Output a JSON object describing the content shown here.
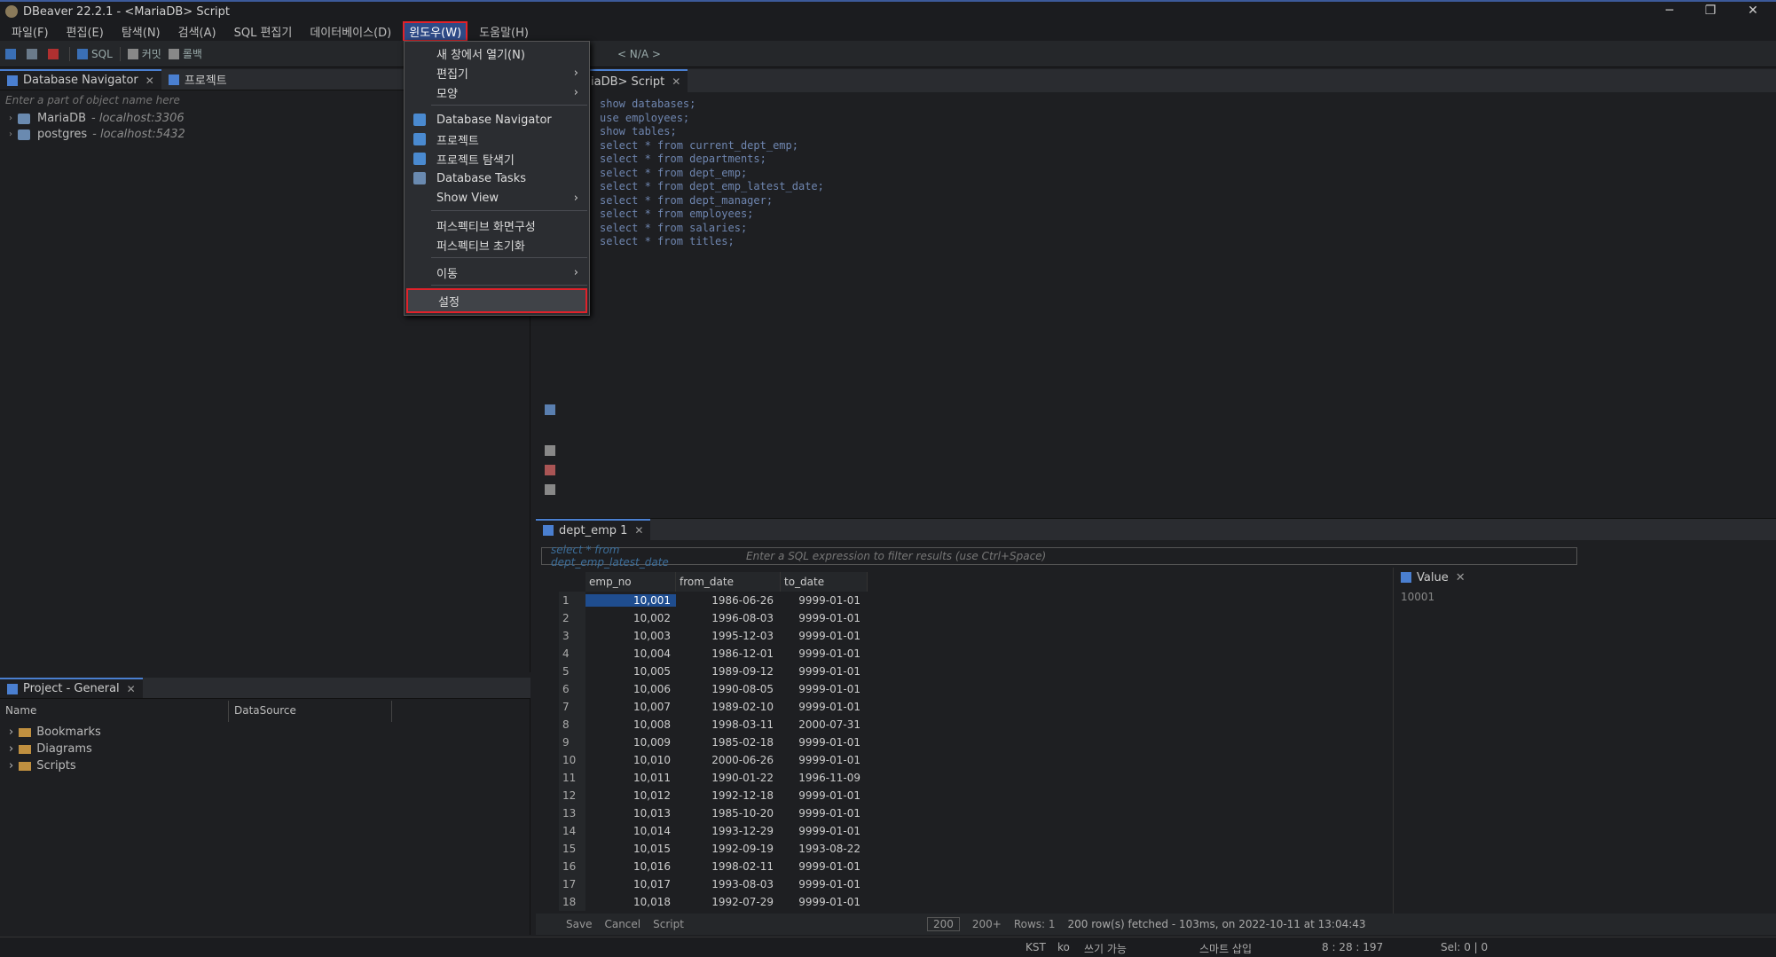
{
  "window": {
    "title": "DBeaver 22.2.1 - <MariaDB> Script",
    "minimize": "─",
    "restore": "❐",
    "close": "✕"
  },
  "menubar": {
    "items": [
      {
        "label": "파일(F)"
      },
      {
        "label": "편집(E)"
      },
      {
        "label": "탐색(N)"
      },
      {
        "label": "검색(A)"
      },
      {
        "label": "SQL 편집기"
      },
      {
        "label": "데이터베이스(D)"
      },
      {
        "label": "윈도우(W)"
      },
      {
        "label": "도움말(H)"
      }
    ]
  },
  "toolbar": {
    "sql_label": "SQL",
    "commit_label": "커밋",
    "rollback_label": "롤백",
    "na_label": "< N/A >"
  },
  "window_menu": {
    "items": [
      {
        "label": "새 창에서 열기(N)",
        "submenu": false
      },
      {
        "label": "편집기",
        "submenu": true
      },
      {
        "label": "모양",
        "submenu": true
      },
      {
        "label": "Database Navigator",
        "submenu": false
      },
      {
        "label": "프로젝트",
        "submenu": false
      },
      {
        "label": "프로젝트 탐색기",
        "submenu": false
      },
      {
        "label": "Database Tasks",
        "submenu": false
      },
      {
        "label": "Show View",
        "submenu": true
      },
      {
        "label": "퍼스펙티브 화면구성",
        "submenu": false
      },
      {
        "label": "퍼스펙티브 초기화",
        "submenu": false
      },
      {
        "label": "이동",
        "submenu": true
      },
      {
        "label": "설정",
        "submenu": false
      }
    ],
    "arrow": "›"
  },
  "navigator": {
    "tab_label": "Database Navigator",
    "project_tab_label": "프로젝트",
    "filter_placeholder": "Enter a part of object name here",
    "connections": [
      {
        "name": "MariaDB",
        "host": "- localhost:3306"
      },
      {
        "name": "postgres",
        "host": "- localhost:5432"
      }
    ]
  },
  "project_panel": {
    "tab_label": "Project - General",
    "col_name": "Name",
    "col_datasource": "DataSource",
    "folders": [
      "Bookmarks",
      "Diagrams",
      "Scripts"
    ]
  },
  "editor": {
    "tab_label": "iaDB> Script",
    "lines": [
      "show databases;",
      "use employees;",
      "show tables;",
      "select * from current_dept_emp;",
      "select * from departments;",
      "select * from dept_emp;",
      "select * from dept_emp_latest_date;",
      "select * from dept_manager;",
      "select * from employees;",
      "select * from salaries;",
      "select * from titles;"
    ]
  },
  "results": {
    "tab_label": "dept_emp 1",
    "query_text": "select * from dept_emp_latest_date",
    "filter_placeholder": "Enter a SQL expression to filter results (use Ctrl+Space)",
    "columns": [
      "emp_no",
      "from_date",
      "to_date"
    ],
    "rows": [
      [
        "1",
        "10,001",
        "1986-06-26",
        "9999-01-01"
      ],
      [
        "2",
        "10,002",
        "1996-08-03",
        "9999-01-01"
      ],
      [
        "3",
        "10,003",
        "1995-12-03",
        "9999-01-01"
      ],
      [
        "4",
        "10,004",
        "1986-12-01",
        "9999-01-01"
      ],
      [
        "5",
        "10,005",
        "1989-09-12",
        "9999-01-01"
      ],
      [
        "6",
        "10,006",
        "1990-08-05",
        "9999-01-01"
      ],
      [
        "7",
        "10,007",
        "1989-02-10",
        "9999-01-01"
      ],
      [
        "8",
        "10,008",
        "1998-03-11",
        "2000-07-31"
      ],
      [
        "9",
        "10,009",
        "1985-02-18",
        "9999-01-01"
      ],
      [
        "10",
        "10,010",
        "2000-06-26",
        "9999-01-01"
      ],
      [
        "11",
        "10,011",
        "1990-01-22",
        "1996-11-09"
      ],
      [
        "12",
        "10,012",
        "1992-12-18",
        "9999-01-01"
      ],
      [
        "13",
        "10,013",
        "1985-10-20",
        "9999-01-01"
      ],
      [
        "14",
        "10,014",
        "1993-12-29",
        "9999-01-01"
      ],
      [
        "15",
        "10,015",
        "1992-09-19",
        "1993-08-22"
      ],
      [
        "16",
        "10,016",
        "1998-02-11",
        "9999-01-01"
      ],
      [
        "17",
        "10,017",
        "1993-08-03",
        "9999-01-01"
      ],
      [
        "18",
        "10,018",
        "1992-07-29",
        "9999-01-01"
      ]
    ],
    "value_panel_title": "Value",
    "value_panel_value": "10001",
    "footer": {
      "save": "Save",
      "cancel": "Cancel",
      "script": "Script",
      "fetch_size": "200",
      "fetch_more": "200+",
      "rows": "Rows: 1",
      "fetched": "200 row(s) fetched - 103ms, on 2022-10-11 at 13:04:43"
    }
  },
  "statusbar": {
    "timezone": "KST",
    "locale": "ko",
    "writable": "쓰기 가능",
    "insert_mode": "스마트 삽입",
    "position": "8 : 28 : 197",
    "selection": "Sel: 0 | 0"
  }
}
